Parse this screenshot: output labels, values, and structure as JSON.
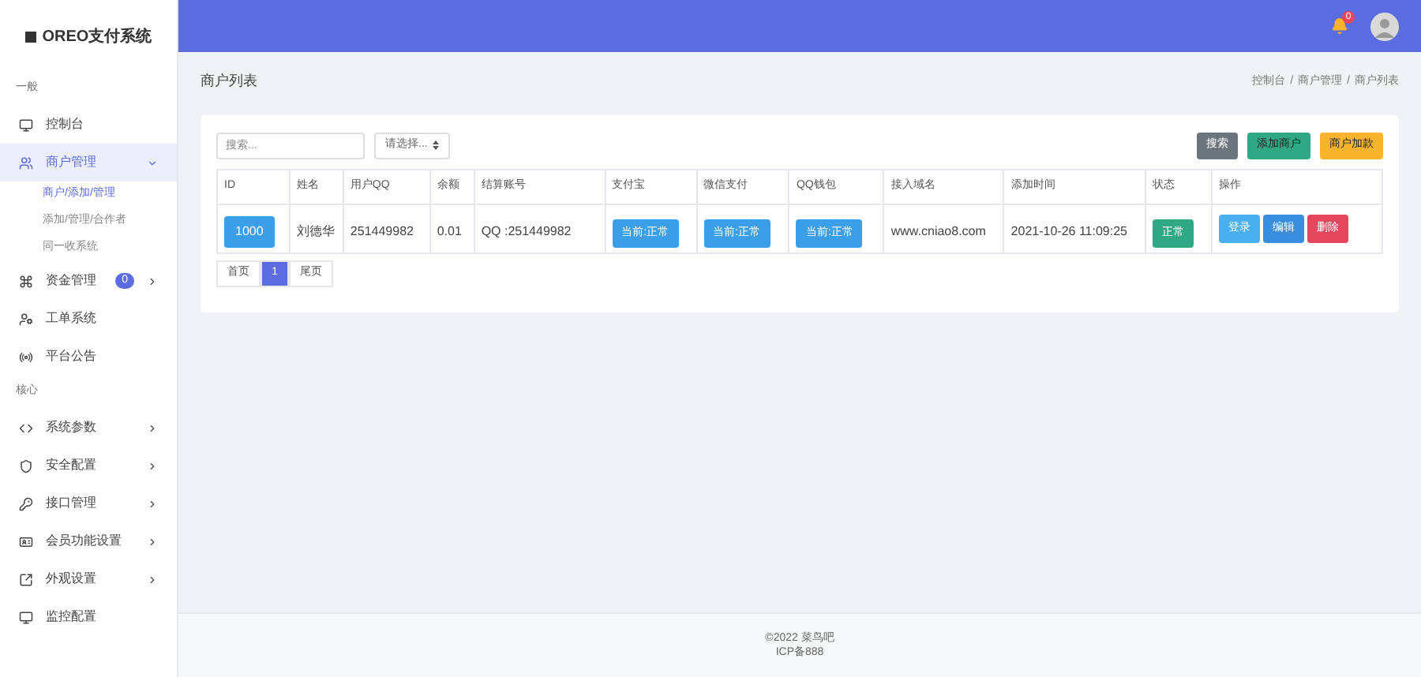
{
  "brand": "OREO支付系统",
  "sidebar": [
    {
      "kind": "section",
      "label": "一般"
    },
    {
      "kind": "item",
      "label": "控制台",
      "selected": false
    },
    {
      "kind": "item",
      "label": "商户管理",
      "selected": true,
      "expanded": true
    },
    {
      "kind": "subitem",
      "label": "商户/添加/管理",
      "selected": true
    },
    {
      "kind": "subitem",
      "label": "添加/管理/合作者",
      "selected": false
    },
    {
      "kind": "subitem",
      "label": "同一收系统",
      "selected": false
    },
    {
      "kind": "item",
      "label": "资金管理",
      "selected": false,
      "expanded": false,
      "badge": "0"
    },
    {
      "kind": "item",
      "label": "工单系统",
      "selected": false
    },
    {
      "kind": "item",
      "label": "平台公告",
      "selected": false
    },
    {
      "kind": "section",
      "label": "核心"
    },
    {
      "kind": "item",
      "label": "系统参数",
      "selected": false,
      "expanded": false
    },
    {
      "kind": "item",
      "label": "安全配置",
      "selected": false,
      "expanded": false
    },
    {
      "kind": "item",
      "label": "接口管理",
      "selected": false,
      "expanded": false
    },
    {
      "kind": "item",
      "label": "会员功能设置",
      "selected": false,
      "expanded": false
    },
    {
      "kind": "item",
      "label": "外观设置",
      "selected": false,
      "expanded": false
    },
    {
      "kind": "item",
      "label": "监控配置",
      "selected": false
    }
  ],
  "topbar": {
    "notification_count": "0"
  },
  "page": {
    "title": "商户列表",
    "breadcrumb": [
      "控制台",
      "商户管理",
      "商户列表"
    ],
    "breadcrumb_separator": "/"
  },
  "filters": {
    "search": {
      "placeholder": "搜索..."
    },
    "select": {
      "value": "请选择..."
    },
    "buttons": [
      {
        "label": "搜索",
        "color": "#6c757d"
      },
      {
        "label": "添加商户",
        "color": "#2fa883"
      },
      {
        "label": "商户加款",
        "color": "#f9b42d"
      }
    ]
  },
  "table": {
    "columns": [
      "ID",
      "姓名",
      "用户QQ",
      "余额",
      "结算账号",
      "支付宝",
      "微信支付",
      "QQ钱包",
      "接入域名",
      "添加时间",
      "状态",
      "操作"
    ],
    "rows": [
      {
        "cells": [
          {
            "kind": "tag",
            "text": "1000"
          },
          {
            "kind": "text",
            "text": "刘德华"
          },
          {
            "kind": "text",
            "text": "251449982"
          },
          {
            "kind": "text",
            "text": "0.01"
          },
          {
            "kind": "text",
            "text": "QQ :251449982"
          },
          {
            "kind": "status",
            "text": "当前:正常"
          },
          {
            "kind": "status",
            "text": "当前:正常"
          },
          {
            "kind": "status",
            "text": "当前:正常"
          },
          {
            "kind": "text",
            "text": "www.cniao8.com"
          },
          {
            "kind": "text",
            "text": "2021-10-26 11:09:25"
          },
          {
            "kind": "success",
            "text": "正常"
          },
          {
            "kind": "actions",
            "buttons": [
              {
                "label": "登录",
                "color": "#4ab0f0"
              },
              {
                "label": "编辑",
                "color": "#3a8ee0"
              },
              {
                "label": "删除",
                "color": "#e6475e"
              }
            ]
          }
        ]
      }
    ]
  },
  "pagination": [
    {
      "label": "首页",
      "selected": false
    },
    {
      "label": "1",
      "selected": true
    },
    {
      "label": "尾页",
      "selected": false
    }
  ],
  "footer": [
    "©2022 菜鸟吧",
    "ICP备888"
  ]
}
